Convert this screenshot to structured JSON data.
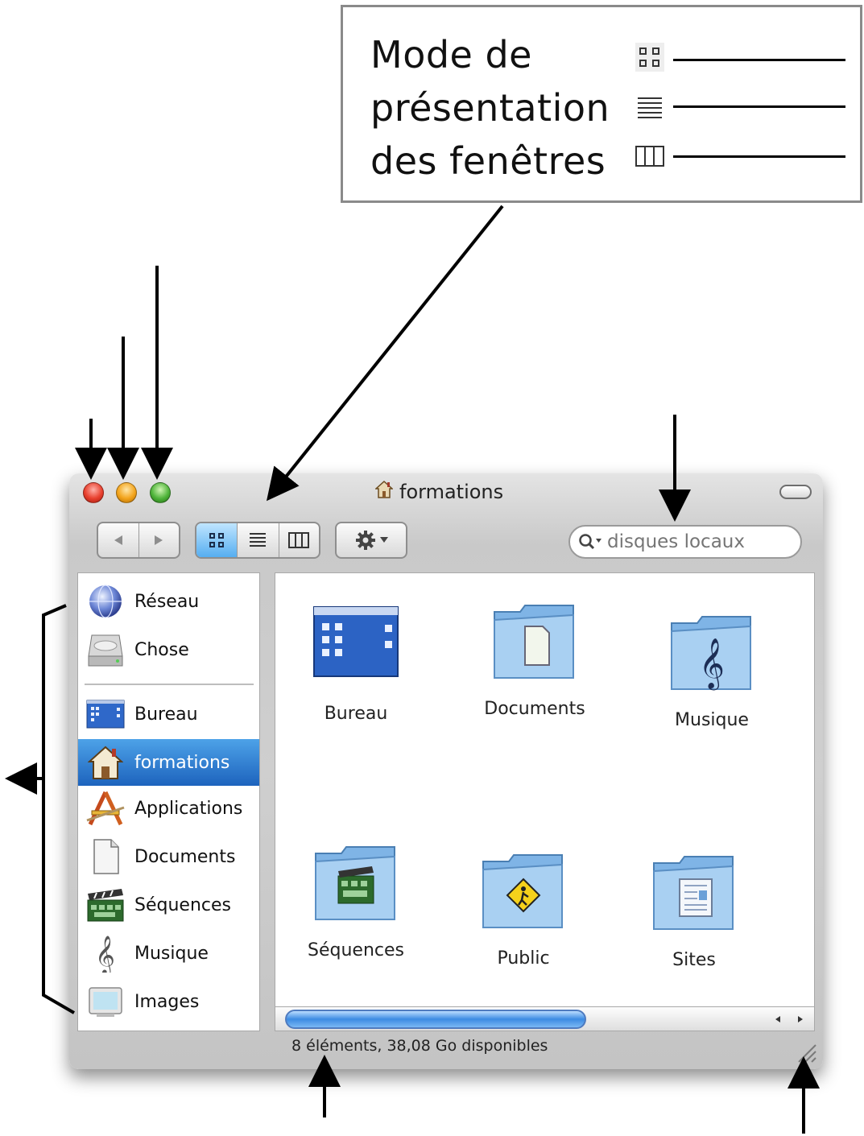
{
  "legend": {
    "title_lines": [
      "Mode de",
      "présentation",
      "des fenêtres"
    ],
    "view_icons": [
      "icon-view-icon",
      "list-view-icon",
      "column-view-icon"
    ]
  },
  "window": {
    "title": "formations",
    "title_icon": "home-icon",
    "toolbar": {
      "back_icon": "back-arrow-icon",
      "forward_icon": "forward-arrow-icon",
      "view_modes": [
        "icon-view-icon",
        "list-view-icon",
        "column-view-icon"
      ],
      "active_view": "icon-view-icon",
      "action_icon": "gear-icon"
    },
    "search": {
      "placeholder": "disques locaux",
      "icon": "search-icon"
    },
    "colors": {
      "selection": "#2a74cc",
      "scroll_thumb": "#3c8be2"
    }
  },
  "sidebar": {
    "devices": [
      {
        "label": "Réseau",
        "icon": "network-globe-icon"
      },
      {
        "label": "Chose",
        "icon": "hard-drive-icon"
      }
    ],
    "places": [
      {
        "label": "Bureau",
        "icon": "desktop-icon"
      },
      {
        "label": "formations",
        "icon": "home-icon",
        "selected": true
      },
      {
        "label": "Applications",
        "icon": "applications-icon"
      },
      {
        "label": "Documents",
        "icon": "document-icon"
      },
      {
        "label": "Séquences",
        "icon": "movie-clapper-icon"
      },
      {
        "label": "Musique",
        "icon": "music-clef-icon"
      },
      {
        "label": "Images",
        "icon": "picture-icon"
      }
    ]
  },
  "content": {
    "items": [
      {
        "label": "Bureau",
        "icon": "desktop-folder-icon"
      },
      {
        "label": "Documents",
        "icon": "documents-folder-icon"
      },
      {
        "label": "Musique",
        "icon": "music-folder-icon"
      },
      {
        "label": "Séquences",
        "icon": "movies-folder-icon"
      },
      {
        "label": "Public",
        "icon": "public-folder-icon"
      },
      {
        "label": "Sites",
        "icon": "sites-folder-icon"
      }
    ]
  },
  "status_bar": {
    "text": "8 éléments, 38,08 Go disponibles"
  }
}
